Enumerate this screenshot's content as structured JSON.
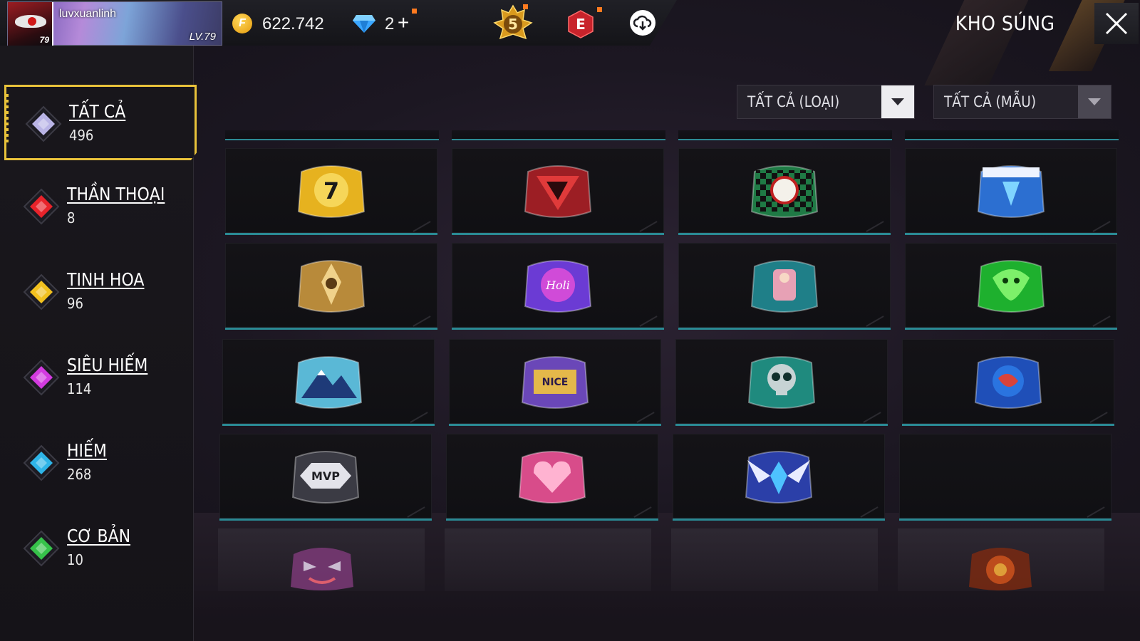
{
  "player": {
    "username": "luvxuanlinh",
    "level_text": "LV.79",
    "avatar_level": "79"
  },
  "currency": {
    "coins": "622.742",
    "diamonds": "2",
    "diamonds_plus": "+"
  },
  "badges": {
    "rank_number": "5",
    "elite_letter": "E"
  },
  "header": {
    "title": "KHO SÚNG"
  },
  "sidebar": {
    "categories": [
      {
        "name": "TẤT CẢ",
        "count": "496",
        "color": "#b9b4e6"
      },
      {
        "name": "THẦN THOẠI",
        "count": "8",
        "color": "#e8232b"
      },
      {
        "name": "TINH HOA",
        "count": "96",
        "color": "#f2c11f"
      },
      {
        "name": "SIÊU HIẾM",
        "count": "114",
        "color": "#d33be0"
      },
      {
        "name": "HIẾM",
        "count": "268",
        "color": "#2fb5e8"
      },
      {
        "name": "CƠ BẢN",
        "count": "10",
        "color": "#36c24a"
      }
    ]
  },
  "filters": {
    "type": {
      "selected": "TẤT CẢ (LOẠI)"
    },
    "style": {
      "selected": "TẤT CẢ (MẪU)"
    }
  },
  "grid": {
    "items": [
      {
        "icon": "golden-seven-crate-icon"
      },
      {
        "icon": "red-blade-crate-icon"
      },
      {
        "icon": "demon-slayer-crate-icon"
      },
      {
        "icon": "blue-crystal-crate-icon"
      },
      {
        "icon": "golden-warrior-crate-icon"
      },
      {
        "icon": "holi-neon-crate-icon"
      },
      {
        "icon": "pink-throne-crate-icon"
      },
      {
        "icon": "green-dragon-crate-icon"
      },
      {
        "icon": "snowy-mountain-crate-icon"
      },
      {
        "icon": "graffiti-crate-icon"
      },
      {
        "icon": "teal-skull-crate-icon"
      },
      {
        "icon": "blue-orb-crate-icon"
      },
      {
        "icon": "mvp-badge-crate-icon"
      },
      {
        "icon": "pink-heart-crate-icon"
      },
      {
        "icon": "winged-emblem-crate-icon"
      },
      {
        "icon": "empty-slot"
      }
    ],
    "partial_row": [
      {
        "icon": "joker-mask-crate-icon"
      },
      {
        "icon": "fire-flower-crate-icon"
      }
    ]
  },
  "colors": {
    "accent_gold": "#e8c23a",
    "tile_border": "#2a8a94"
  }
}
